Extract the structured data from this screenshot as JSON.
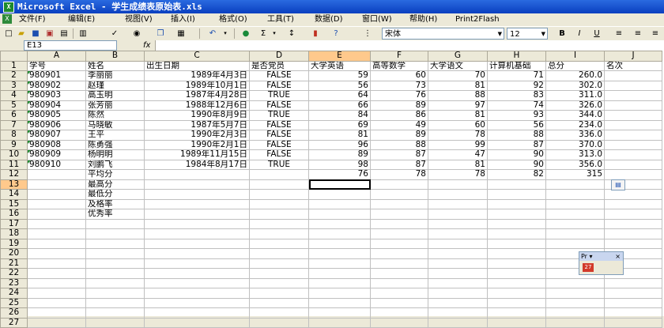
{
  "window": {
    "title": "Microsoft Excel - 学生成绩表原始表.xls"
  },
  "menu": [
    "文件(F)",
    "编辑(E)",
    "视图(V)",
    "插入(I)",
    "格式(O)",
    "工具(T)",
    "数据(D)",
    "窗口(W)",
    "帮助(H)",
    "Print2Flash"
  ],
  "toolbar": {
    "font": "宋体",
    "size": "12",
    "bold": "B",
    "italic": "I",
    "underline": "U",
    "sum": "Σ"
  },
  "formula_bar": {
    "name_box": "E13",
    "fx": "fx",
    "value": ""
  },
  "columns": [
    "A",
    "B",
    "C",
    "D",
    "E",
    "F",
    "G",
    "H",
    "I",
    "J"
  ],
  "selected_column": "E",
  "selected_row": 13,
  "rows": [
    [
      "学号",
      "姓名",
      "出生日期",
      "是否党员",
      "大学英语",
      "高等数学",
      "大学语文",
      "计算机基础",
      "总分",
      "名次"
    ],
    [
      "980901",
      "李丽丽",
      "1989年4月3日",
      "FALSE",
      "59",
      "60",
      "70",
      "71",
      "260.0",
      ""
    ],
    [
      "980902",
      "赵瑾",
      "1989年10月1日",
      "FALSE",
      "56",
      "73",
      "81",
      "92",
      "302.0",
      ""
    ],
    [
      "980903",
      "高玉明",
      "1987年4月28日",
      "TRUE",
      "64",
      "76",
      "88",
      "83",
      "311.0",
      ""
    ],
    [
      "980904",
      "张芳丽",
      "1988年12月6日",
      "FALSE",
      "66",
      "89",
      "97",
      "74",
      "326.0",
      ""
    ],
    [
      "980905",
      "陈然",
      "1990年8月9日",
      "TRUE",
      "84",
      "86",
      "81",
      "93",
      "344.0",
      ""
    ],
    [
      "980906",
      "马晓敏",
      "1987年5月7日",
      "FALSE",
      "69",
      "49",
      "60",
      "56",
      "234.0",
      ""
    ],
    [
      "980907",
      "王平",
      "1990年2月3日",
      "FALSE",
      "81",
      "89",
      "78",
      "88",
      "336.0",
      ""
    ],
    [
      "980908",
      "陈勇强",
      "1990年2月1日",
      "FALSE",
      "96",
      "88",
      "99",
      "87",
      "370.0",
      ""
    ],
    [
      "980909",
      "杨明明",
      "1989年11月15日",
      "FALSE",
      "89",
      "87",
      "47",
      "90",
      "313.0",
      ""
    ],
    [
      "980910",
      "刘鹏飞",
      "1984年8月17日",
      "TRUE",
      "98",
      "87",
      "81",
      "90",
      "356.0",
      ""
    ],
    [
      "",
      "平均分",
      "",
      "",
      "76",
      "78",
      "78",
      "82",
      "315",
      ""
    ],
    [
      "",
      "最高分",
      "",
      "",
      "",
      "",
      "",
      "",
      "",
      ""
    ],
    [
      "",
      "最低分",
      "",
      "",
      "",
      "",
      "",
      "",
      "",
      ""
    ],
    [
      "",
      "及格率",
      "",
      "",
      "",
      "",
      "",
      "",
      "",
      ""
    ],
    [
      "",
      "优秀率",
      "",
      "",
      "",
      "",
      "",
      "",
      "",
      ""
    ]
  ],
  "total_rows": 27,
  "floating_toolbar": {
    "title": "Pr",
    "close": "×"
  }
}
